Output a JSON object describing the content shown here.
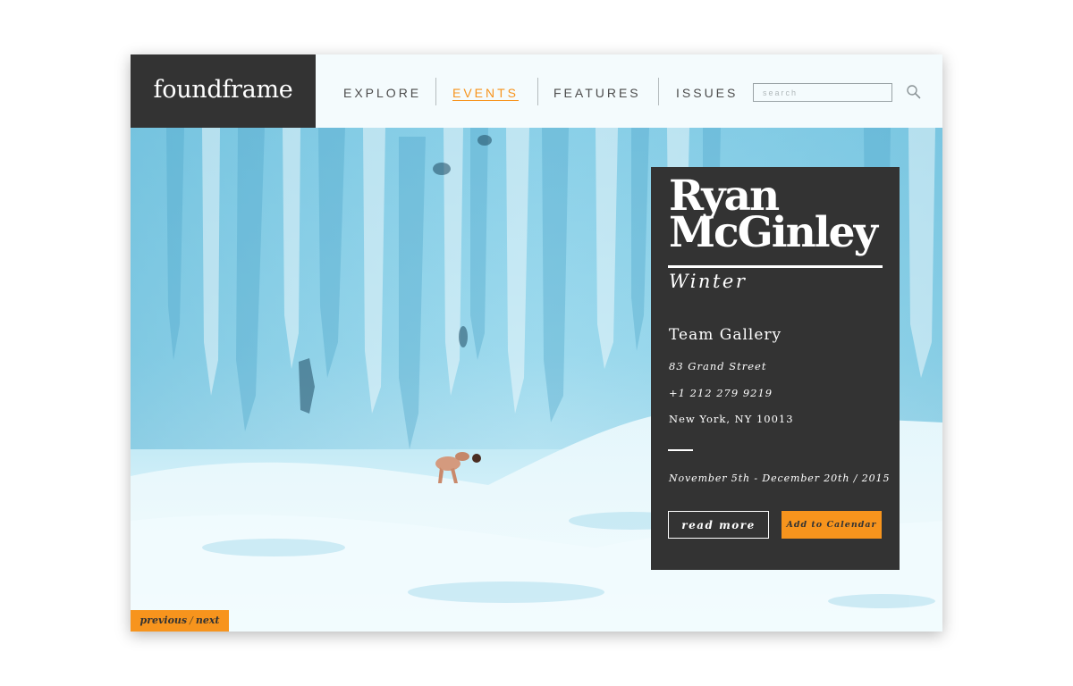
{
  "header": {
    "logo": "foundframe",
    "nav": [
      {
        "label": "EXPLORE",
        "active": false
      },
      {
        "label": "EVENTS",
        "active": true
      },
      {
        "label": "FEATURES",
        "active": false
      },
      {
        "label": "ISSUES",
        "active": false
      }
    ],
    "search": {
      "placeholder": "search",
      "value": ""
    },
    "icons": {
      "search": "search-icon"
    }
  },
  "event": {
    "artist_line1": "Ryan",
    "artist_line2": "McGinley",
    "title": "Winter",
    "gallery": "Team Gallery",
    "address": "83 Grand Street",
    "phone": "+1 212 279 9219",
    "city": "New York, NY 10013",
    "dates": "November 5th - December 20th / 2015",
    "read_more": "read more",
    "add_to_calendar": "Add to Calendar"
  },
  "pager": {
    "previous": "previous",
    "separator": "/",
    "next": "next"
  },
  "colors": {
    "accent": "#f7941d",
    "dark": "#333333",
    "header_bg": "#f4fbfd"
  }
}
